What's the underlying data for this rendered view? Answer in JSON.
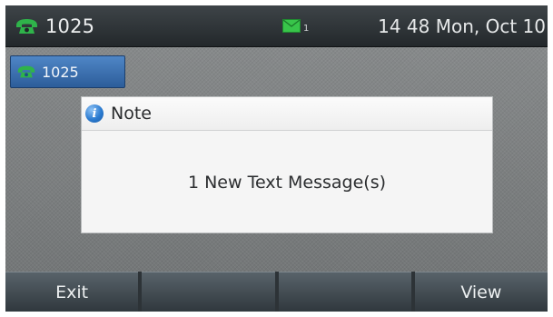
{
  "status_bar": {
    "account_label": "1025",
    "account_icon": "handset-icon",
    "message_icon": "envelope-icon",
    "message_count": "1",
    "datetime": "14 48 Mon, Oct 10"
  },
  "line_key": {
    "label": "1025",
    "icon": "handset-icon"
  },
  "dialog": {
    "title": "Note",
    "icon": "info-icon",
    "message": "1 New Text Message(s)"
  },
  "softkeys": [
    {
      "label": "Exit"
    },
    {
      "label": ""
    },
    {
      "label": ""
    },
    {
      "label": "View"
    }
  ],
  "colors": {
    "handset_green": "#2fb34a",
    "envelope_green": "#38c54a",
    "line_key_blue": "#3a6fb0"
  }
}
